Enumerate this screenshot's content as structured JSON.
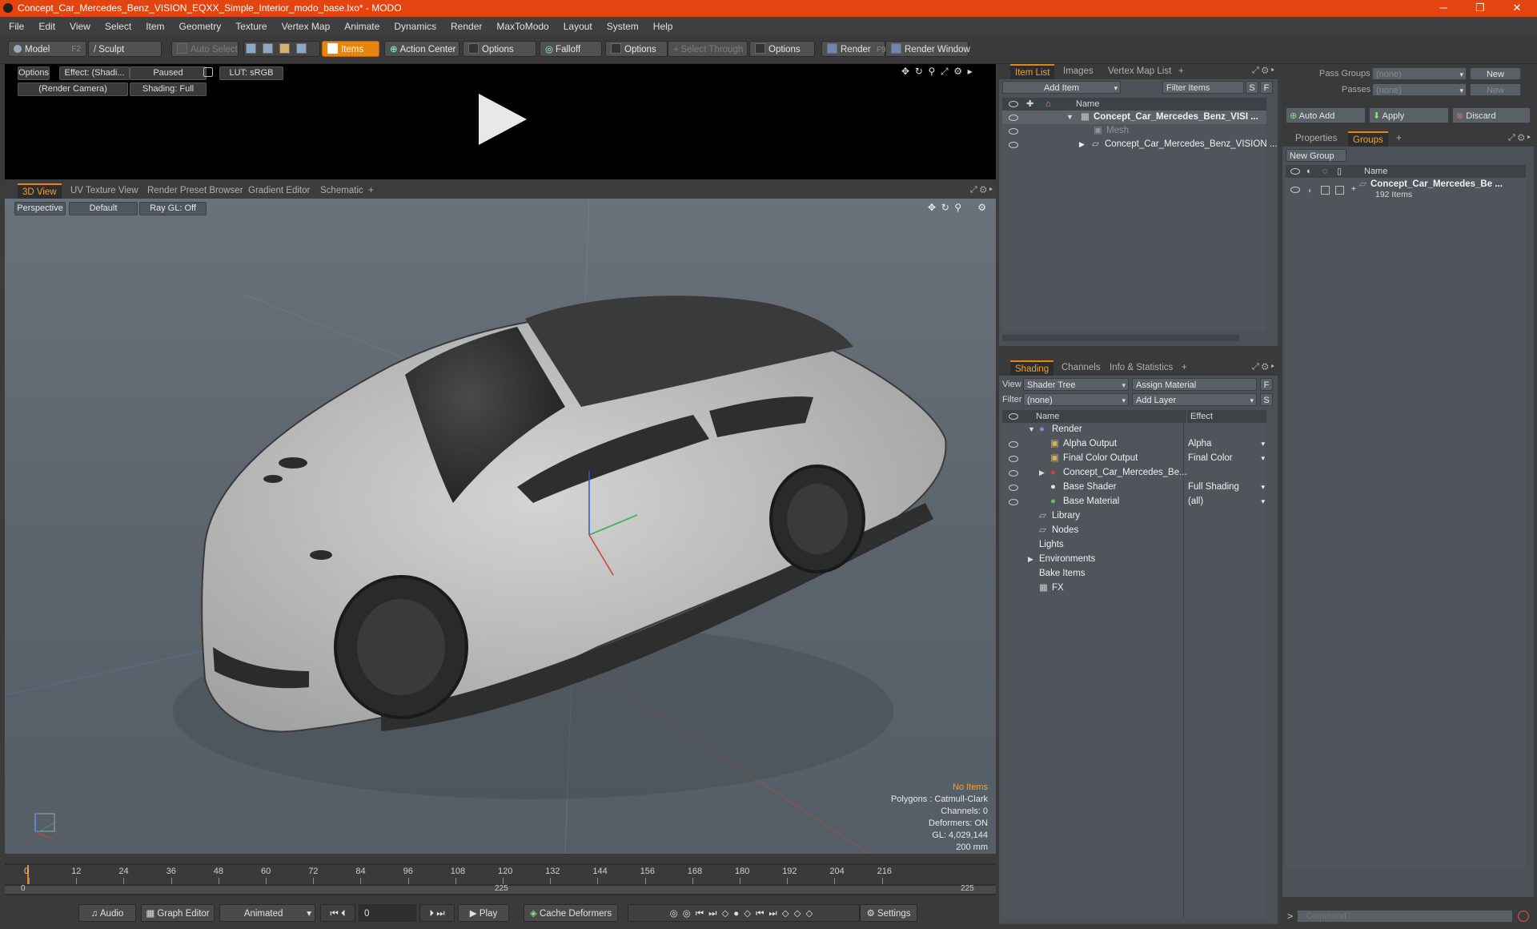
{
  "window": {
    "title": "Concept_Car_Mercedes_Benz_VISION_EQXX_Simple_Interior_modo_base.lxo* - MODO",
    "minimize": "─",
    "maximize": "❐",
    "close": "✕"
  },
  "menu": [
    "File",
    "Edit",
    "View",
    "Select",
    "Item",
    "Geometry",
    "Texture",
    "Vertex Map",
    "Animate",
    "Dynamics",
    "Render",
    "MaxToModo",
    "Layout",
    "System",
    "Help"
  ],
  "toolbar": {
    "model": "Model",
    "model_key": "F2",
    "sculpt": "Sculpt",
    "auto_select": "Auto Select",
    "items": "Items",
    "action_center": "Action Center",
    "options1": "Options",
    "falloff": "Falloff",
    "options2": "Options",
    "select_through": "Select Through",
    "options3": "Options",
    "render": "Render",
    "render_key": "F9",
    "render_window": "Render Window"
  },
  "preview": {
    "options": "Options",
    "effect": "Effect: (Shadi...",
    "paused": "Paused",
    "lut": "LUT: sRGB",
    "camera": "(Render Camera)",
    "shading": "Shading: Full"
  },
  "view_tabs": [
    "3D View",
    "UV Texture View",
    "Render Preset Browser",
    "Gradient Editor",
    "Schematic",
    "+"
  ],
  "viewport": {
    "perspective": "Perspective",
    "default": "Default",
    "raygl": "Ray GL: Off",
    "stats": {
      "no_items": "No Items",
      "polygons": "Polygons : Catmull-Clark",
      "channels": "Channels: 0",
      "deformers": "Deformers: ON",
      "gl": "GL: 4,029,144",
      "scale": "200 mm"
    }
  },
  "timeline": {
    "ticks": [
      "0",
      "12",
      "24",
      "36",
      "48",
      "60",
      "72",
      "84",
      "96",
      "108",
      "120",
      "132",
      "144",
      "156",
      "168",
      "180",
      "192",
      "204",
      "216"
    ],
    "range_start": "0",
    "range_mid": "225",
    "range_end": "225"
  },
  "bottombar": {
    "audio": "Audio",
    "graph_editor": "Graph Editor",
    "animated": "Animated",
    "frame": "0",
    "play": "Play",
    "cache_deformers": "Cache Deformers",
    "settings": "Settings"
  },
  "item_list": {
    "tabs": [
      "Item List",
      "Images",
      "Vertex Map List",
      "+"
    ],
    "add_item": "Add Item",
    "filter_items": "Filter Items",
    "s": "S",
    "f": "F",
    "col_name": "Name",
    "rows": [
      {
        "label": "Concept_Car_Mercedes_Benz_VISI ..."
      },
      {
        "label": "Mesh"
      },
      {
        "label": "Concept_Car_Mercedes_Benz_VISION ..."
      }
    ]
  },
  "shading": {
    "tabs": [
      "Shading",
      "Channels",
      "Info & Statistics",
      "+"
    ],
    "view_label": "View",
    "view_value": "Shader Tree",
    "assign_material": "Assign Material",
    "f": "F",
    "filter_label": "Filter",
    "filter_value": "(none)",
    "add_layer": "Add Layer",
    "s": "S",
    "col_name": "Name",
    "col_effect": "Effect",
    "rows": [
      {
        "name": "Render",
        "effect": ""
      },
      {
        "name": "Alpha Output",
        "effect": "Alpha"
      },
      {
        "name": "Final Color Output",
        "effect": "Final Color"
      },
      {
        "name": "Concept_Car_Mercedes_Be...",
        "effect": ""
      },
      {
        "name": "Base Shader",
        "effect": "Full Shading"
      },
      {
        "name": "Base Material",
        "effect": "(all)"
      },
      {
        "name": "Library",
        "effect": ""
      },
      {
        "name": "Nodes",
        "effect": ""
      },
      {
        "name": "Lights",
        "effect": ""
      },
      {
        "name": "Environments",
        "effect": ""
      },
      {
        "name": "Bake Items",
        "effect": ""
      },
      {
        "name": "FX",
        "effect": ""
      }
    ]
  },
  "passes": {
    "pass_groups_label": "Pass Groups",
    "pass_groups_value": "(none)",
    "new1": "New",
    "passes_label": "Passes",
    "passes_value": "(none)",
    "new2": "New",
    "auto_add": "Auto Add",
    "apply": "Apply",
    "discard": "Discard"
  },
  "groups": {
    "tabs": [
      "Properties",
      "Groups",
      "+"
    ],
    "new_group": "New Group",
    "col_name": "Name",
    "group_name": "Concept_Car_Mercedes_Be ...",
    "group_count": "192 Items"
  },
  "command": {
    "placeholder": "Command"
  },
  "colors": {
    "accent": "#e8850f",
    "titlebar": "#e4440f",
    "viewport_bg": "#5f6870"
  }
}
